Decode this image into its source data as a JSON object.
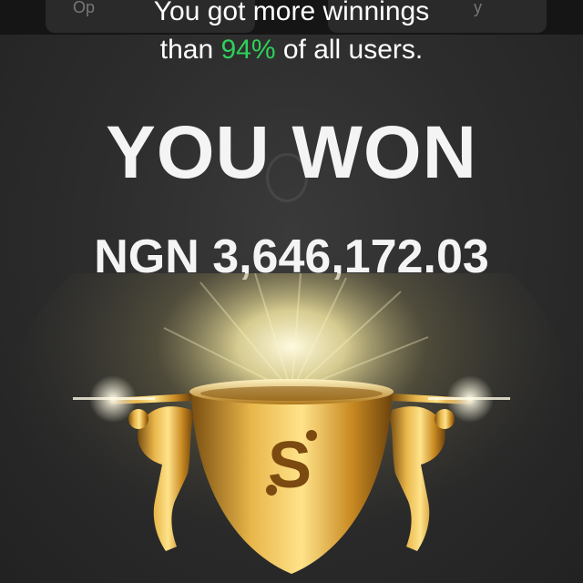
{
  "header": {
    "tab_left_label": "Op",
    "tab_right_label": "y"
  },
  "result": {
    "line1": "You got more winnings",
    "line2_prefix": "than ",
    "percent": "94%",
    "line2_suffix": " of all users.",
    "title": "YOU WON",
    "amount": "NGN 3,646,172.03"
  },
  "trophy": {
    "logo_letter": "S",
    "icon": "trophy-icon"
  },
  "colors": {
    "accent_green": "#2ed15a",
    "gold": "#d9a23a",
    "background": "#2d2d2d"
  }
}
